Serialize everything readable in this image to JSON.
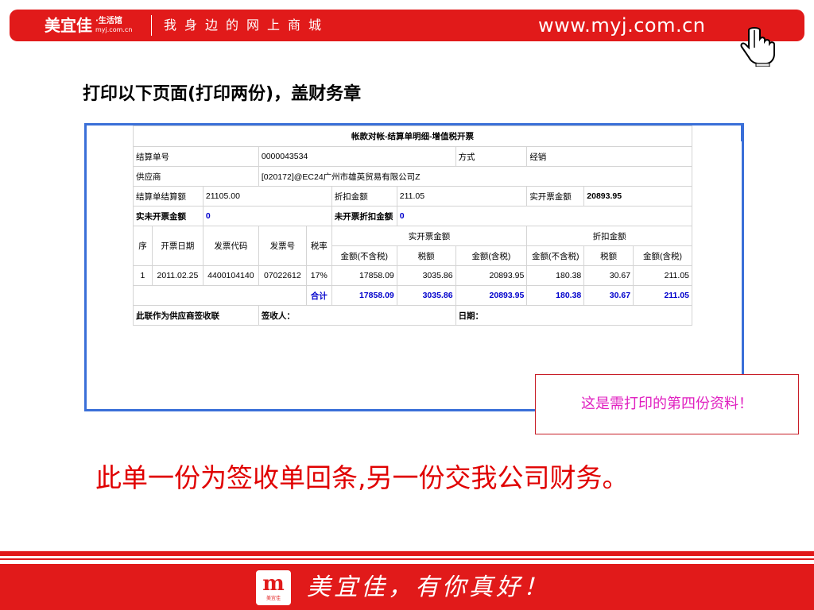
{
  "header": {
    "brand": "美宜佳",
    "brand_sub1": "·生活馆",
    "brand_sub2": "myj.com.cn",
    "slogan": "我身边的网上商城",
    "url": "www.myj.com.cn",
    "cursor_icon": "hand-pointer-icon"
  },
  "instruction": "打印以下页面(打印两份)，盖财务章",
  "doc": {
    "title": "帐款对帐-结算单明细-增值税开票",
    "row1": {
      "label_no": "结算单号",
      "no": "0000043534",
      "label_mode": "方式",
      "mode": "经销"
    },
    "row2": {
      "label_supplier": "供应商",
      "supplier": "[020172]@EC24广州市雄英贸易有限公司Z"
    },
    "row3": {
      "label_total": "结算单结算额",
      "total": "21105.00",
      "label_discount": "折扣金额",
      "discount": "211.05",
      "label_actual": "实开票金额",
      "actual": "20893.95"
    },
    "row4": {
      "label_remaining": "实未开票金额",
      "remaining": "0",
      "label_un_discount": "未开票折扣金额",
      "un_discount": "0"
    },
    "head": {
      "seq": "序",
      "date": "开票日期",
      "code": "发票代码",
      "num": "发票号",
      "rate": "税率",
      "group_actual": "实开票金额",
      "group_discount": "折扣金额",
      "sub": [
        "金额(不含税)",
        "税额",
        "金额(含税)",
        "金额(不含税)",
        "税额",
        "金额(含税)"
      ]
    },
    "rows": [
      {
        "seq": "1",
        "date": "2011.02.25",
        "code": "4400104140",
        "num": "07022612",
        "rate": "17%",
        "a_net": "17858.09",
        "a_tax": "3035.86",
        "a_gross": "20893.95",
        "d_net": "180.38",
        "d_tax": "30.67",
        "d_gross": "211.05"
      }
    ],
    "totals": {
      "label": "合计",
      "a_net": "17858.09",
      "a_tax": "3035.86",
      "a_gross": "20893.95",
      "d_net": "180.38",
      "d_tax": "30.67",
      "d_gross": "211.05"
    },
    "sign": {
      "label_copy": "此联作为供应商签收联",
      "label_receiver": "签收人：",
      "label_date": "日期："
    }
  },
  "note": "这是需打印的第四份资料！",
  "headline": "此单一份为签收单回条,另一份交我公司财务。",
  "footer": {
    "logo_mark": "m",
    "logo_text": "美宜佳",
    "tagline": "美宜佳，有你真好！"
  },
  "colors": {
    "brand_red": "#e11a1a",
    "frame_blue": "#3a6fd8",
    "link_blue": "#0000cc",
    "note_magenta": "#e020c0"
  }
}
